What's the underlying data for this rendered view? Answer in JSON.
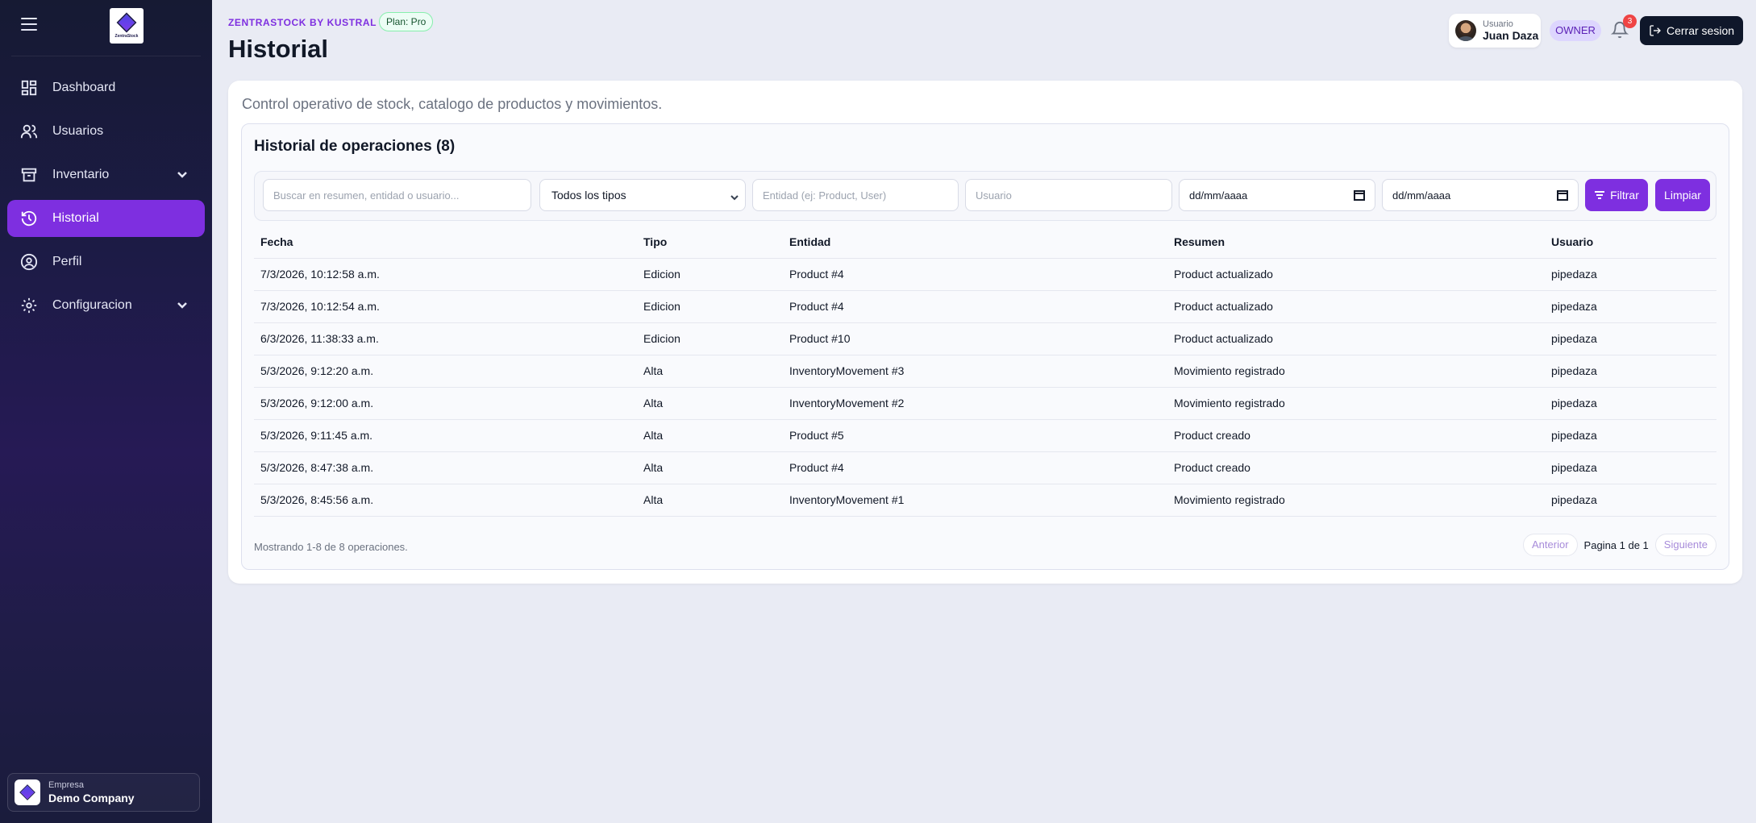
{
  "sidebar": {
    "logo_text": "ZentraStock",
    "items": [
      {
        "label": "Dashboard",
        "icon": "dashboard-icon"
      },
      {
        "label": "Usuarios",
        "icon": "users-icon"
      },
      {
        "label": "Inventario",
        "icon": "archive-icon"
      },
      {
        "label": "Historial",
        "icon": "history-icon"
      },
      {
        "label": "Perfil",
        "icon": "user-circle-icon"
      },
      {
        "label": "Configuracion",
        "icon": "gear-icon"
      }
    ],
    "company": {
      "label": "Empresa",
      "name": "Demo Company"
    }
  },
  "header": {
    "brand": "ZENTRASTOCK BY KUSTRAL",
    "plan": "Plan: Pro",
    "title": "Historial",
    "user_label": "Usuario",
    "user_name": "Juan Daza",
    "role": "OWNER",
    "notifications": "3",
    "logout_label": "Cerrar sesion"
  },
  "main": {
    "description": "Control operativo de stock, catalogo de productos y movimientos.",
    "section_title": "Historial de operaciones (8)",
    "filters": {
      "search_placeholder": "Buscar en resumen, entidad o usuario...",
      "type_selected": "Todos los tipos",
      "entity_placeholder": "Entidad (ej: Product, User)",
      "user_placeholder": "Usuario",
      "date_from": "dd/mm/aaaa",
      "date_to": "dd/mm/aaaa",
      "filter_label": "Filtrar",
      "clear_label": "Limpiar"
    },
    "table": {
      "headers": [
        "Fecha",
        "Tipo",
        "Entidad",
        "Resumen",
        "Usuario"
      ],
      "rows": [
        [
          "7/3/2026, 10:12:58 a.m.",
          "Edicion",
          "Product #4",
          "Product actualizado",
          "pipedaza"
        ],
        [
          "7/3/2026, 10:12:54 a.m.",
          "Edicion",
          "Product #4",
          "Product actualizado",
          "pipedaza"
        ],
        [
          "6/3/2026, 11:38:33 a.m.",
          "Edicion",
          "Product #10",
          "Product actualizado",
          "pipedaza"
        ],
        [
          "5/3/2026, 9:12:20 a.m.",
          "Alta",
          "InventoryMovement #3",
          "Movimiento registrado",
          "pipedaza"
        ],
        [
          "5/3/2026, 9:12:00 a.m.",
          "Alta",
          "InventoryMovement #2",
          "Movimiento registrado",
          "pipedaza"
        ],
        [
          "5/3/2026, 9:11:45 a.m.",
          "Alta",
          "Product #5",
          "Product creado",
          "pipedaza"
        ],
        [
          "5/3/2026, 8:47:38 a.m.",
          "Alta",
          "Product #4",
          "Product creado",
          "pipedaza"
        ],
        [
          "5/3/2026, 8:45:56 a.m.",
          "Alta",
          "InventoryMovement #1",
          "Movimiento registrado",
          "pipedaza"
        ]
      ]
    },
    "footer": {
      "showing": "Mostrando 1-8 de 8 operaciones.",
      "prev": "Anterior",
      "page_info": "Pagina 1 de 1",
      "next": "Siguiente"
    }
  },
  "colors": {
    "accent": "#7e2fe0",
    "sidebar_bg": "#1c1b45",
    "logout_bg": "#0f172a"
  }
}
